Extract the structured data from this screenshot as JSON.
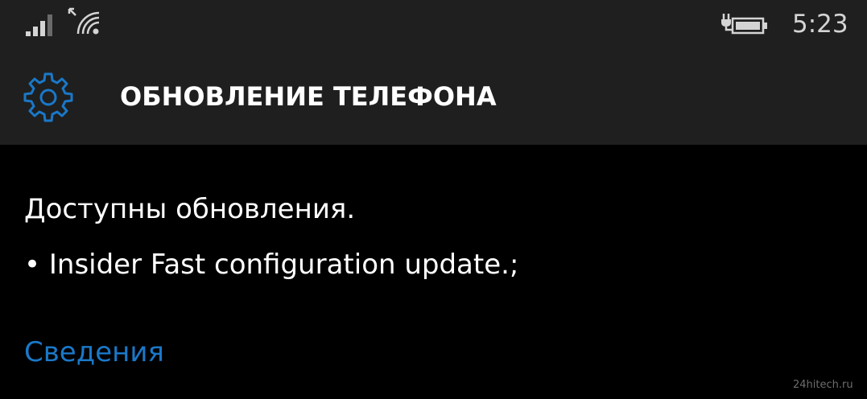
{
  "status_bar": {
    "time": "5:23",
    "signal_icon": "signal-strength-icon",
    "wifi_icon": "wifi-icon",
    "battery_icon": "battery-charging-icon"
  },
  "header": {
    "icon": "gear-icon",
    "title": "ОБНОВЛЕНИЕ ТЕЛЕФОНА"
  },
  "content": {
    "status": "Доступны обновления.",
    "updates": [
      "• Insider Fast configuration update.;"
    ],
    "details_link": "Сведения"
  },
  "watermark": "24hitech.ru",
  "colors": {
    "accent": "#1a78c8",
    "bar_background": "#1f1f1f",
    "background": "#000000"
  }
}
